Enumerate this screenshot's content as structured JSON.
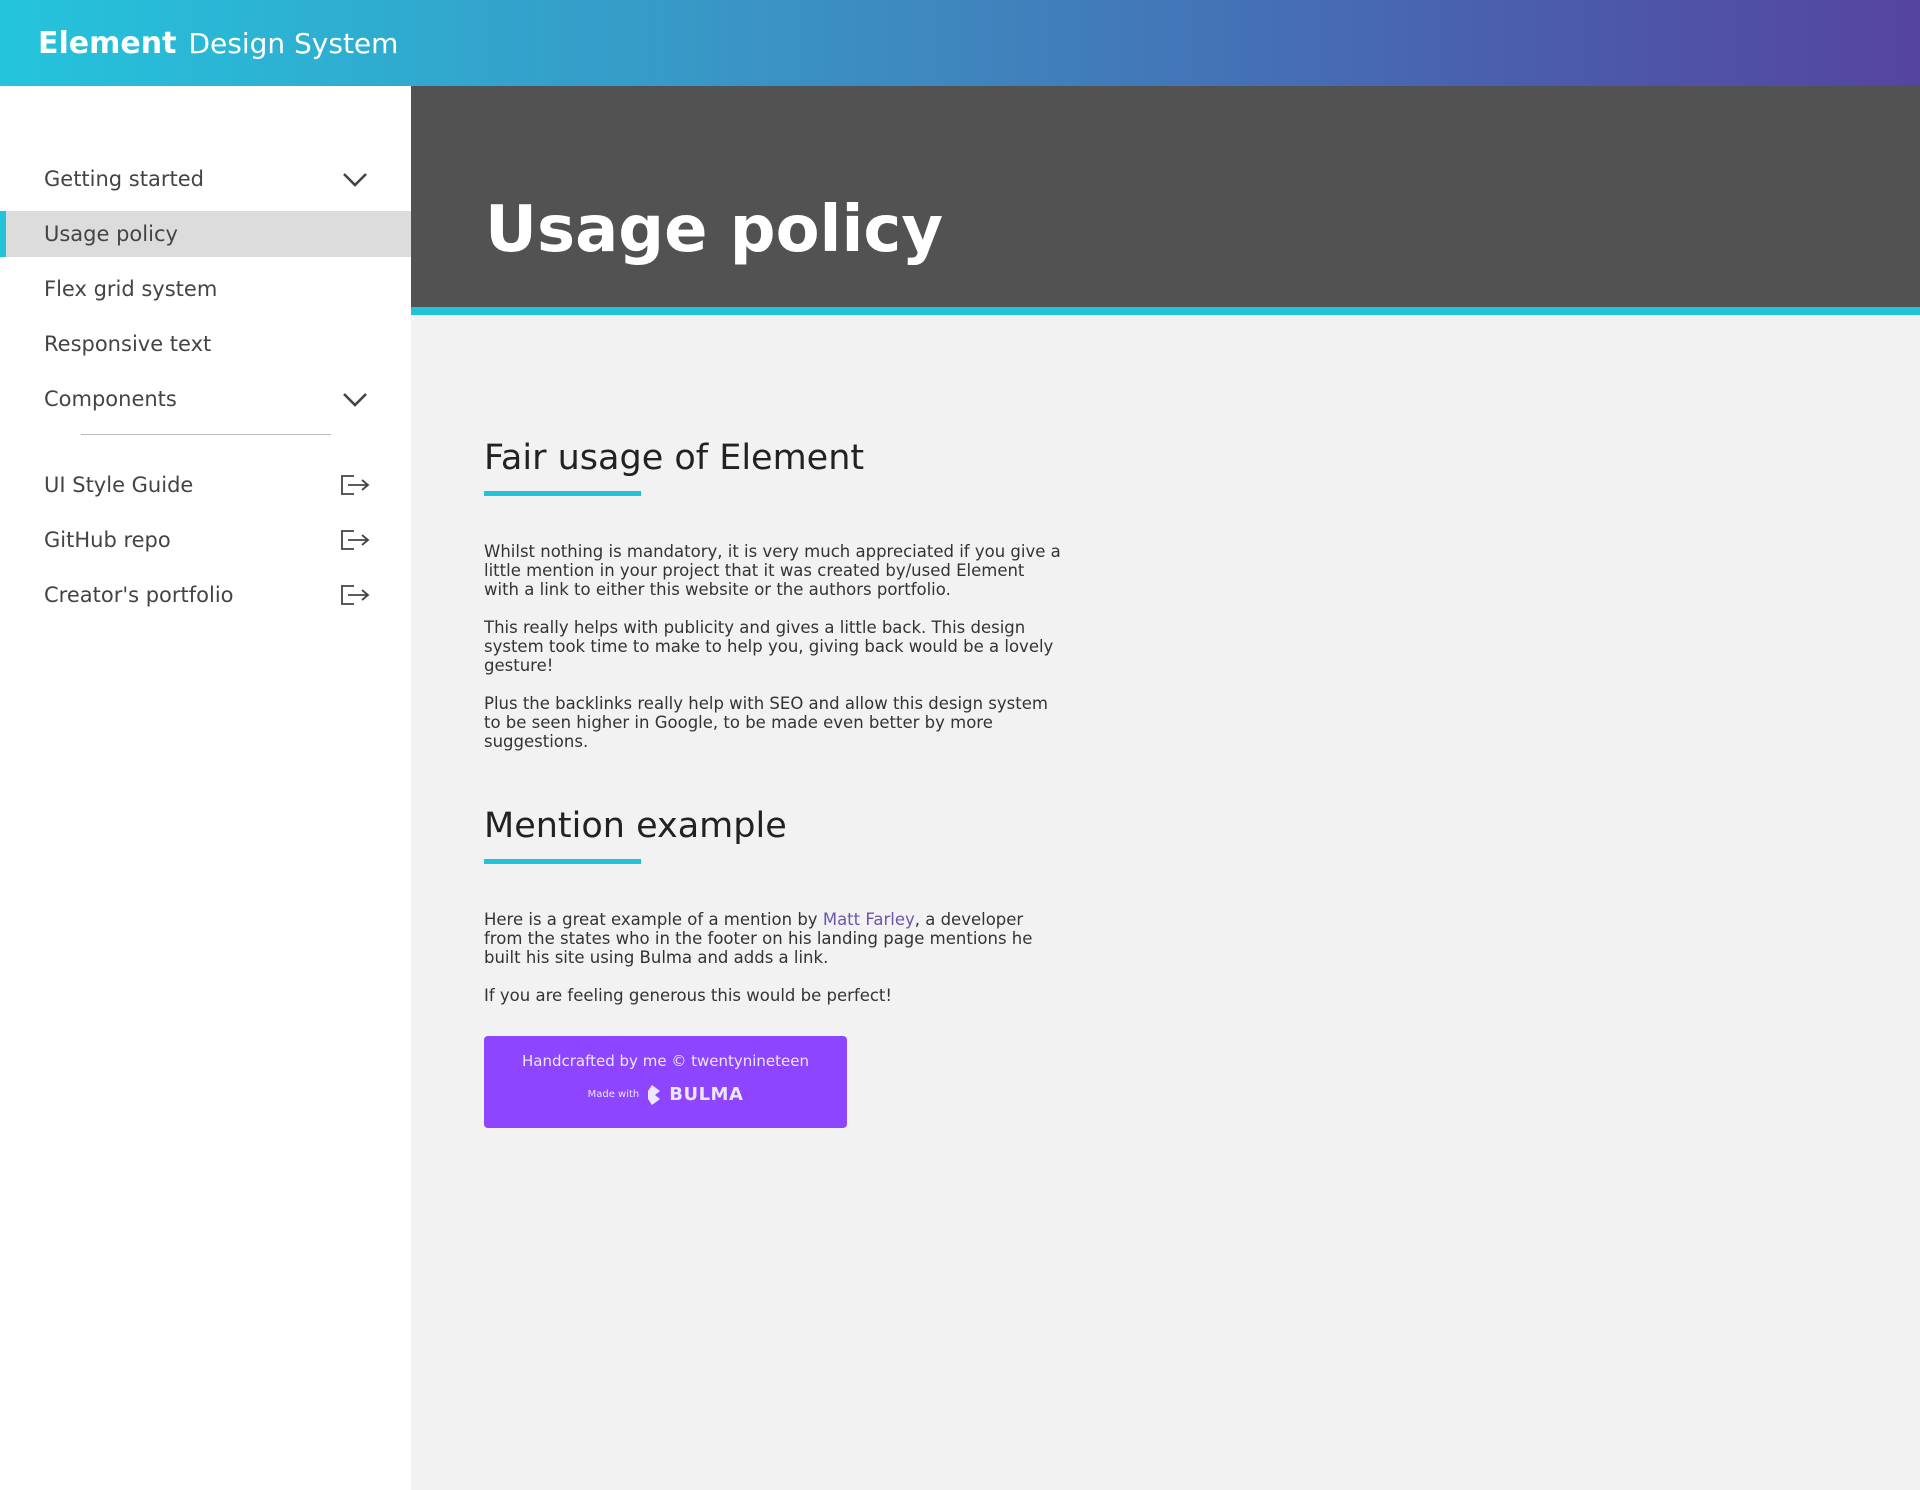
{
  "brand": {
    "strong": "Element",
    "light": "Design System"
  },
  "sidebar": {
    "items": [
      {
        "label": "Getting started",
        "icon": "chevron-down-icon"
      },
      {
        "label": "Usage policy",
        "active": true
      },
      {
        "label": "Flex grid system"
      },
      {
        "label": "Responsive text"
      },
      {
        "label": "Components",
        "icon": "chevron-down-icon"
      }
    ],
    "external": [
      {
        "label": "UI Style Guide",
        "icon": "external-link-icon"
      },
      {
        "label": "GitHub repo",
        "icon": "external-link-icon"
      },
      {
        "label": "Creator's portfolio",
        "icon": "external-link-icon"
      }
    ]
  },
  "hero": {
    "title": "Usage policy"
  },
  "sections": {
    "fair": {
      "title": "Fair usage of Element",
      "p1": "Whilst nothing is mandatory, it is very much appreciated if you give a little mention in your project that it was created by/used Element with a link to either this website or the authors portfolio.",
      "p2": "This really helps with publicity and gives a little back. This design system took time to make to help you, giving back would be a lovely gesture!",
      "p3": "Plus the backlinks really help with SEO and allow this design system to be seen higher in Google, to be made even better by more suggestions."
    },
    "mention": {
      "title": "Mention example",
      "p1_before": "Here is a great example of a mention by ",
      "p1_link": "Matt Farley",
      "p1_after": ", a developer from the states who in the footer on his landing page mentions he built his site using Bulma and adds a link.",
      "p2": "If you are feeling generous this would be perfect!"
    }
  },
  "example_badge": {
    "line1": "Handcrafted by me © twentynineteen",
    "made_with": "Made with",
    "bulma": "BULMA"
  },
  "colors": {
    "accent": "#22c3d8",
    "hero_bg": "#525252",
    "badge_bg": "#8d45ff",
    "link": "#6b57a8"
  }
}
